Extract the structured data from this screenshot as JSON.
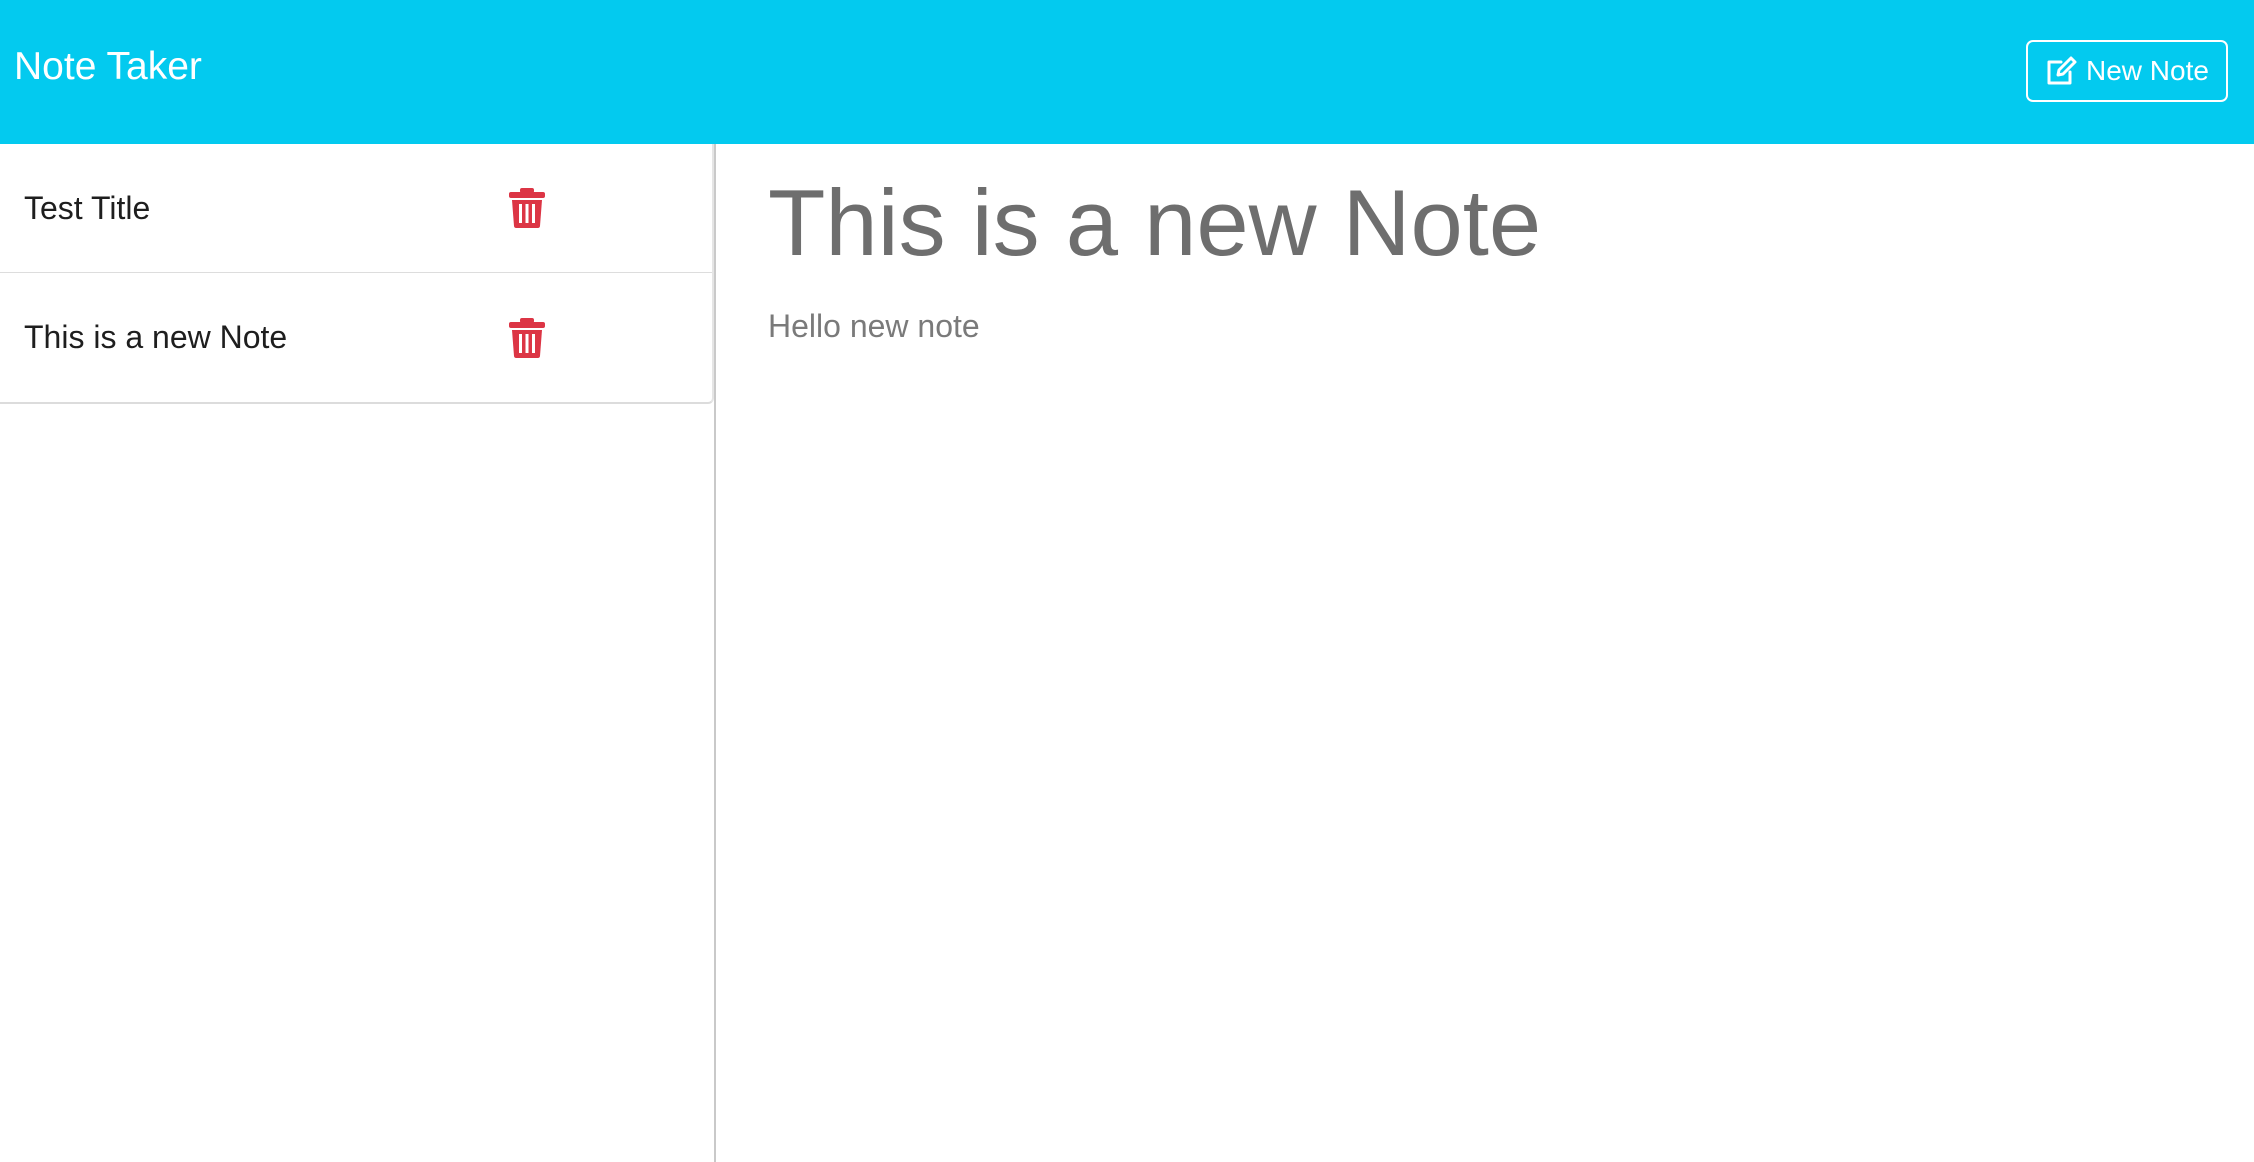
{
  "navbar": {
    "brand": "Note Taker",
    "new_note_button": {
      "label": "New Note",
      "icon": "pen-to-square-icon"
    }
  },
  "sidebar": {
    "notes": [
      {
        "title": "Test Title",
        "delete_icon": "trash-icon"
      },
      {
        "title": "This is a new Note",
        "delete_icon": "trash-icon"
      }
    ]
  },
  "main": {
    "note_title": "This is a new Note",
    "note_body": "Hello new note"
  },
  "colors": {
    "navbar_bg": "#03caef",
    "delete_icon": "#dc3545",
    "note_text": "#6e6e6e"
  }
}
